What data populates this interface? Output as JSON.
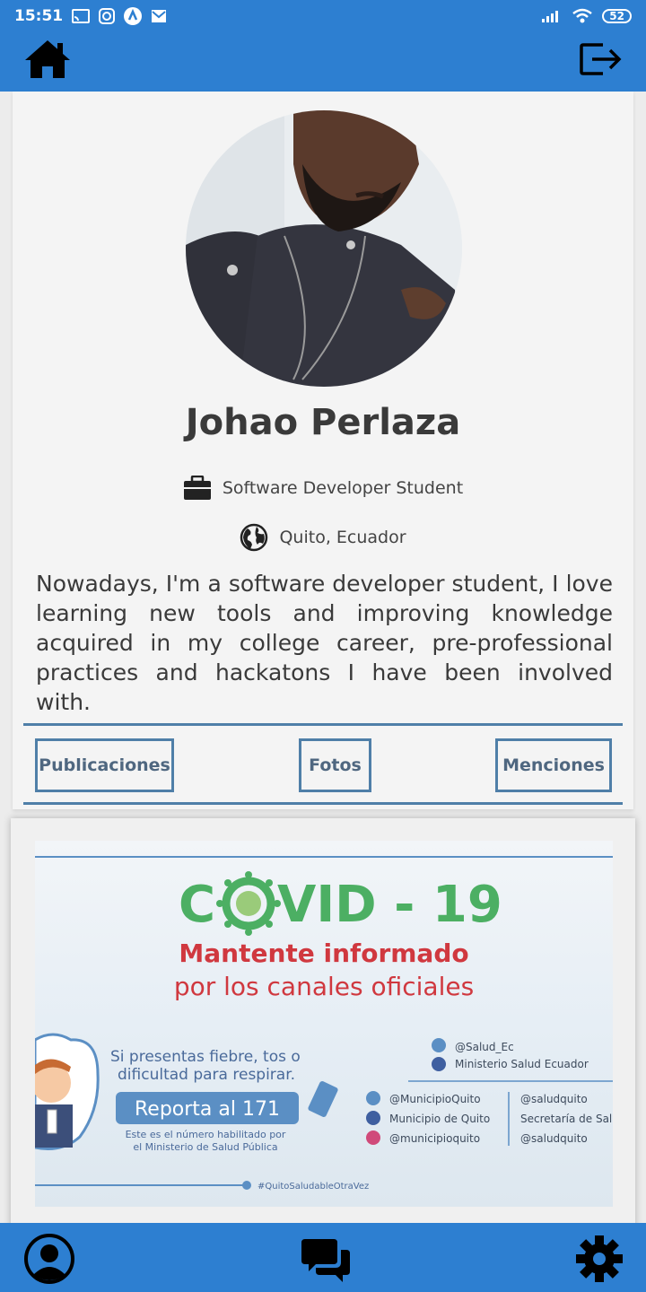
{
  "status_bar": {
    "time": "15:51",
    "battery": "52"
  },
  "profile": {
    "name": "Johao Perlaza",
    "occupation": "Software Developer Student",
    "location": "Quito, Ecuador",
    "bio": "Nowadays, I'm a software developer student, I love  learning new tools and improving knowledge acquired in my college career, pre-professional practices and hackatons I have been involved with."
  },
  "tabs": [
    {
      "label": "Publicaciones"
    },
    {
      "label": "Fotos"
    },
    {
      "label": "Menciones"
    }
  ],
  "post": {
    "title_left": "C",
    "title_right": "VID - 19",
    "headline": "Mantente informado",
    "subheadline": "por los canales oficiales",
    "symptoms_line1": "Si presentas fiebre, tos o",
    "symptoms_line2": "dificultad para respirar.",
    "report_label": "Reporta al 171",
    "report_note_line1": "Este es el número habilitado por",
    "report_note_line2": "el Ministerio de Salud Pública",
    "twitter_national": "@Salud_Ec",
    "facebook_national": "Ministerio Salud Ecuador",
    "twitter_city": "@MunicipioQuito",
    "facebook_city": "Municipio de Quito",
    "instagram_city": "@municipioquito",
    "twitter_health": "@saludquito",
    "facebook_health": "Secretaría de Sal",
    "instagram_health": "@saludquito",
    "hashtag": "#QuitoSaludableOtraVez"
  },
  "colors": {
    "primary": "#2d7fd1",
    "tab_border": "#4f7fa8",
    "covid_green": "#4caf63",
    "headline_red": "#d0383f",
    "report_blue": "#5b8fc4"
  },
  "icons": {
    "home": "home-icon",
    "logout": "logout-icon",
    "briefcase": "briefcase-icon",
    "globe": "globe-icon",
    "profile": "user-circle-icon",
    "chat": "chat-icon",
    "settings": "gear-icon"
  }
}
